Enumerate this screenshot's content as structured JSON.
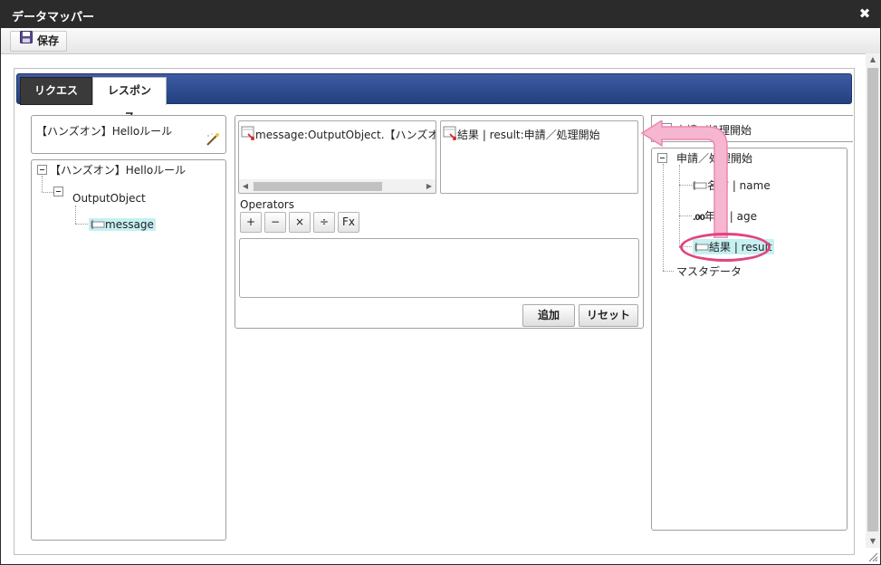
{
  "window": {
    "title": "データマッパー",
    "close_glyph": "✖"
  },
  "toolbar": {
    "save_label": "保存"
  },
  "tabs": [
    {
      "label": "リクエスト",
      "active": false
    },
    {
      "label": "レスポンス",
      "active": true
    }
  ],
  "left": {
    "title": "【ハンズオン】Helloルール",
    "tree": {
      "root": "【ハンズオン】Helloルール",
      "child": "OutputObject",
      "leaf": "message"
    }
  },
  "center": {
    "source_path": "message:OutputObject.【ハンズオン】Helloルール",
    "target_path": "結果 | result:申請／処理開始",
    "operators_label": "Operators",
    "operators": [
      "+",
      "−",
      "×",
      "÷",
      "Fx"
    ],
    "expression": "",
    "add_label": "追加",
    "reset_label": "リセット"
  },
  "right": {
    "header": "申請／処理開始",
    "tree": {
      "root": "申請／処理開始",
      "items": [
        {
          "label": "名前 | name",
          "icon": "string-field-icon"
        },
        {
          "label": "年齢 | age",
          "icon": "number-field-icon"
        },
        {
          "label": "結果 | result",
          "icon": "string-field-icon",
          "selected": true
        }
      ],
      "sibling": "マスタデータ"
    }
  },
  "colors": {
    "tabbar": "#2f4d92",
    "highlight": "#c6f0f2",
    "callout": "#e0457f",
    "arrow": "#f7b6d0"
  }
}
